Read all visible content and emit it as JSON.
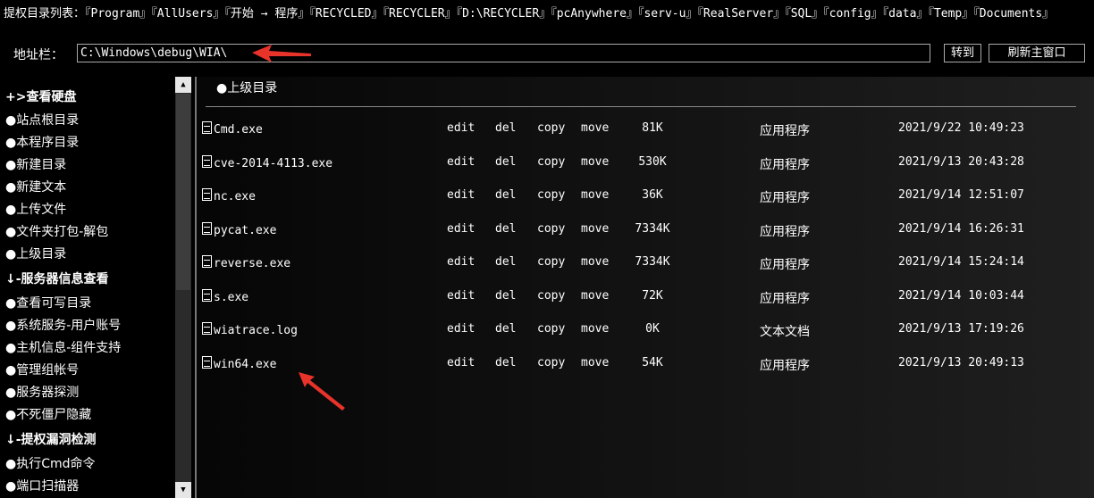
{
  "topbar": {
    "privilege_dirs": "提权目录列表：『Program』『AllUsers』『开始 → 程序』『RECYCLED』『RECYCLER』『D:\\RECYCLER』『pcAnywhere』『serv-u』『RealServer』『SQL』『config』『data』『Temp』『Documents』",
    "address_label": "地址栏：",
    "address_value": "C:\\Windows\\debug\\WIA\\",
    "go_label": "转到",
    "refresh_label": "刷新主窗口"
  },
  "sidebar": {
    "section1": "+>查看硬盘",
    "section1_items": [
      "●站点根目录",
      "●本程序目录",
      "●新建目录",
      "●新建文本",
      "●上传文件",
      "●文件夹打包-解包",
      "●上级目录"
    ],
    "section2": "↓-服务器信息查看",
    "section2_items": [
      "●查看可写目录",
      "●系统服务-用户账号",
      "●主机信息-组件支持",
      "●管理组帐号",
      "●服务器探测",
      "●不死僵尸隐藏"
    ],
    "section3": "↓-提权漏洞检测",
    "section3_items": [
      "●执行Cmd命令",
      "●端口扫描器"
    ]
  },
  "main": {
    "parent_dir": "●上级目录",
    "actions": {
      "edit": "edit",
      "del": "del",
      "copy": "copy",
      "move": "move"
    },
    "files": [
      {
        "name": "Cmd.exe",
        "size": "81K",
        "type": "应用程序",
        "date": "2021/9/22 10:49:23"
      },
      {
        "name": "cve-2014-4113.exe",
        "size": "530K",
        "type": "应用程序",
        "date": "2021/9/13 20:43:28"
      },
      {
        "name": "nc.exe",
        "size": "36K",
        "type": "应用程序",
        "date": "2021/9/14 12:51:07"
      },
      {
        "name": "pycat.exe",
        "size": "7334K",
        "type": "应用程序",
        "date": "2021/9/14 16:26:31"
      },
      {
        "name": "reverse.exe",
        "size": "7334K",
        "type": "应用程序",
        "date": "2021/9/14 15:24:14"
      },
      {
        "name": "s.exe",
        "size": "72K",
        "type": "应用程序",
        "date": "2021/9/14 10:03:44"
      },
      {
        "name": "wiatrace.log",
        "size": "0K",
        "type": "文本文档",
        "date": "2021/9/13 17:19:26"
      },
      {
        "name": "win64.exe",
        "size": "54K",
        "type": "应用程序",
        "date": "2021/9/13 20:49:13"
      }
    ]
  },
  "colors": {
    "annotation_arrow": "#e8332a",
    "background": "#000000"
  }
}
